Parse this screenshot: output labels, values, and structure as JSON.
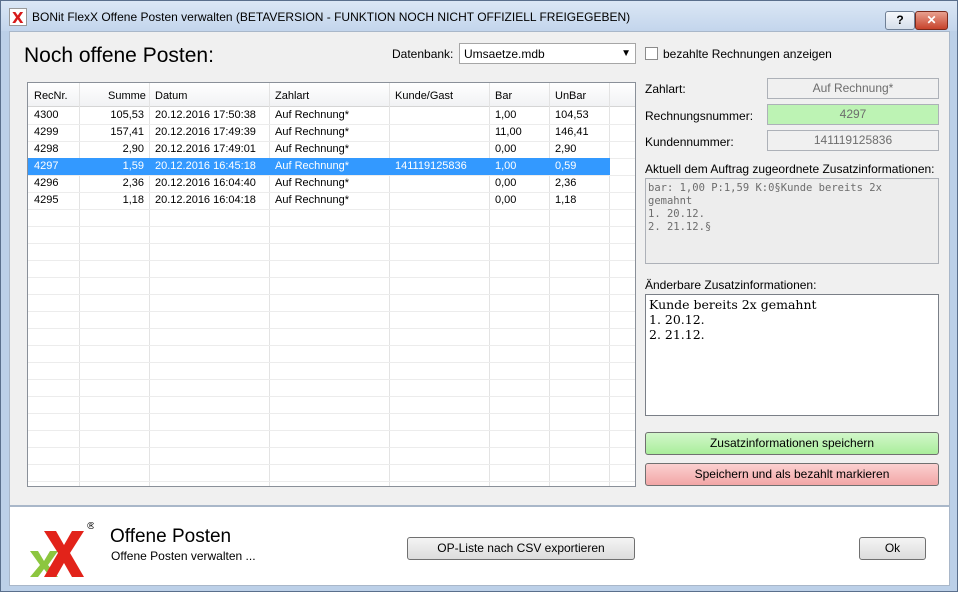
{
  "window": {
    "title": "BONit FlexX Offene Posten verwalten (BETAVERSION - FUNKTION NOCH NICHT OFFIZIELL FREIGEGEBEN)",
    "help_label": "?",
    "close_label": "✕"
  },
  "main": {
    "heading": "Noch offene Posten:",
    "datenbank_label": "Datenbank:",
    "datenbank_value": "Umsaetze.mdb",
    "show_paid_label": "bezahlte Rechnungen anzeigen",
    "show_paid_checked": false
  },
  "table": {
    "columns": [
      "RecNr.",
      "Summe",
      "Datum",
      "Zahlart",
      "Kunde/Gast",
      "Bar",
      "UnBar"
    ],
    "rows": [
      [
        "4300",
        "105,53",
        "20.12.2016 17:50:38",
        "Auf Rechnung*",
        "",
        "1,00",
        "104,53"
      ],
      [
        "4299",
        "157,41",
        "20.12.2016 17:49:39",
        "Auf Rechnung*",
        "",
        "11,00",
        "146,41"
      ],
      [
        "4298",
        "2,90",
        "20.12.2016 17:49:01",
        "Auf Rechnung*",
        "",
        "0,00",
        "2,90"
      ],
      [
        "4297",
        "1,59",
        "20.12.2016 16:45:18",
        "Auf Rechnung*",
        "141119125836",
        "1,00",
        "0,59"
      ],
      [
        "4296",
        "2,36",
        "20.12.2016 16:04:40",
        "Auf Rechnung*",
        "",
        "0,00",
        "2,36"
      ],
      [
        "4295",
        "1,18",
        "20.12.2016 16:04:18",
        "Auf Rechnung*",
        "",
        "0,00",
        "1,18"
      ]
    ],
    "selected_row": 3
  },
  "details": {
    "zahlart_label": "Zahlart:",
    "zahlart_value": "Auf Rechnung*",
    "rechnungsnummer_label": "Rechnungsnummer:",
    "rechnungsnummer_value": "4297",
    "kundennummer_label": "Kundennummer:",
    "kundennummer_value": "141119125836",
    "current_info_label": "Aktuell dem Auftrag zugeordnete Zusatzinformationen:",
    "current_info_value": "bar: 1,00 P:1,59 K:0§Kunde bereits 2x\ngemahnt\n1. 20.12.\n2. 21.12.§",
    "editable_info_label": "Änderbare Zusatzinformationen:",
    "editable_info_value": "Kunde bereits 2x gemahnt\n1. 20.12.\n2. 21.12.",
    "save_info_button": "Zusatzinformationen speichern",
    "save_paid_button": "Speichern und als bezahlt markieren"
  },
  "footer": {
    "title": "Offene Posten",
    "subtitle": "Offene Posten verwalten ...",
    "logo_registered": "®",
    "export_button": "OP-Liste nach CSV exportieren",
    "ok_button": "Ok"
  },
  "colors": {
    "selection": "#3399ff",
    "green_field": "#bdf3b4",
    "green_button": "#a9ed9b",
    "red_button": "#f2a6a6",
    "logo_green": "#8cc63f",
    "logo_red": "#e2231a"
  }
}
